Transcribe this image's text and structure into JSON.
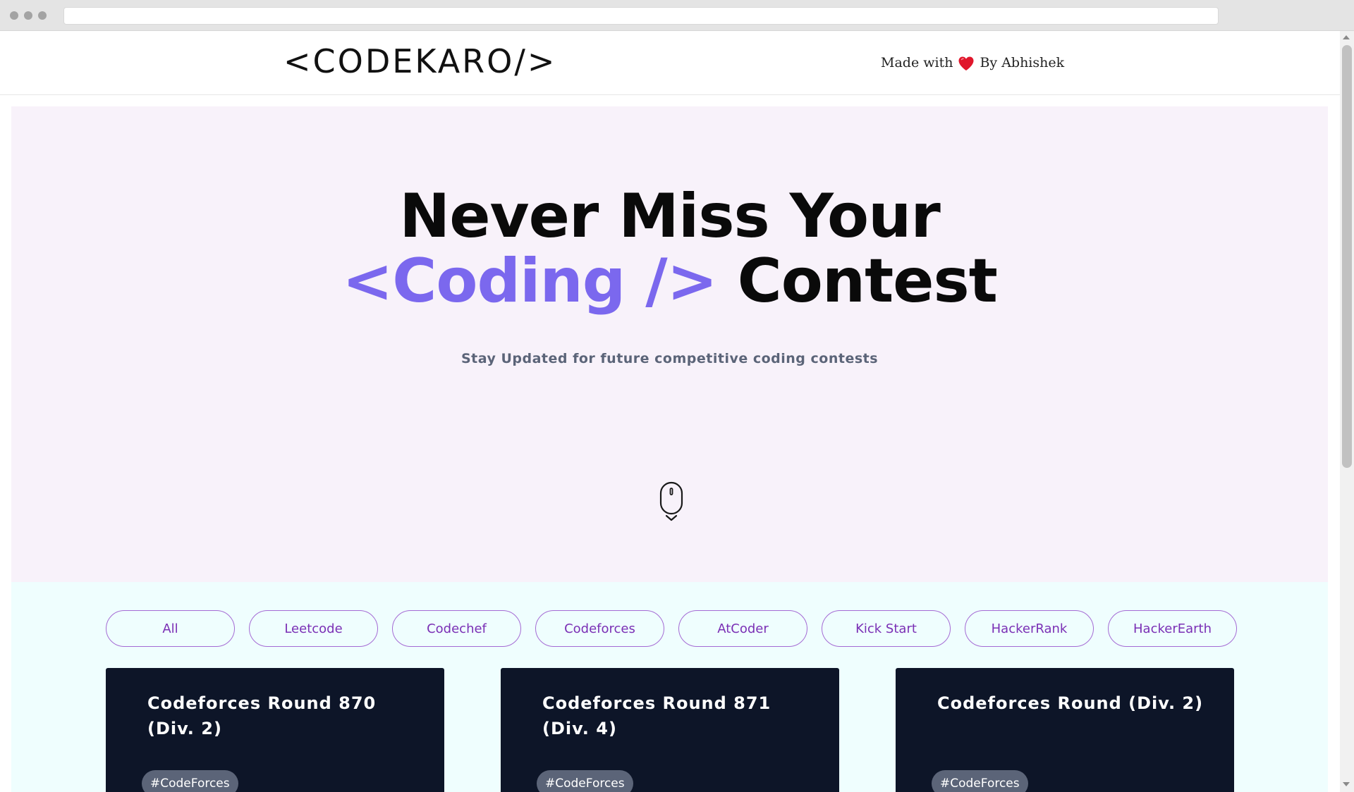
{
  "header": {
    "logo": "<CODEKARO/>",
    "credit_prefix": "Made with",
    "credit_suffix": "By Abhishek"
  },
  "hero": {
    "title_line1": "Never Miss Your",
    "title_accent": "<Coding />",
    "title_rest": "Contest",
    "subtitle": "Stay Updated for future competitive coding contests"
  },
  "filters": [
    "All",
    "Leetcode",
    "Codechef",
    "Codeforces",
    "AtCoder",
    "Kick Start",
    "HackerRank",
    "HackerEarth"
  ],
  "cards": [
    {
      "title": "Codeforces Round 870 (Div. 2)",
      "tag": "#CodeForces"
    },
    {
      "title": "Codeforces Round 871 (Div. 4)",
      "tag": "#CodeForces"
    },
    {
      "title": "Codeforces Round (Div. 2)",
      "tag": "#CodeForces"
    }
  ],
  "colors": {
    "accent": "#7b68ee",
    "hero_bg": "#f8f2fa",
    "contests_bg": "#effefe",
    "card_bg": "#0d1528",
    "filter_text": "#7a2fb5",
    "heart": "#e0162b"
  },
  "icons": {
    "heart": "heart-icon",
    "scroll": "mouse-scroll-icon"
  }
}
